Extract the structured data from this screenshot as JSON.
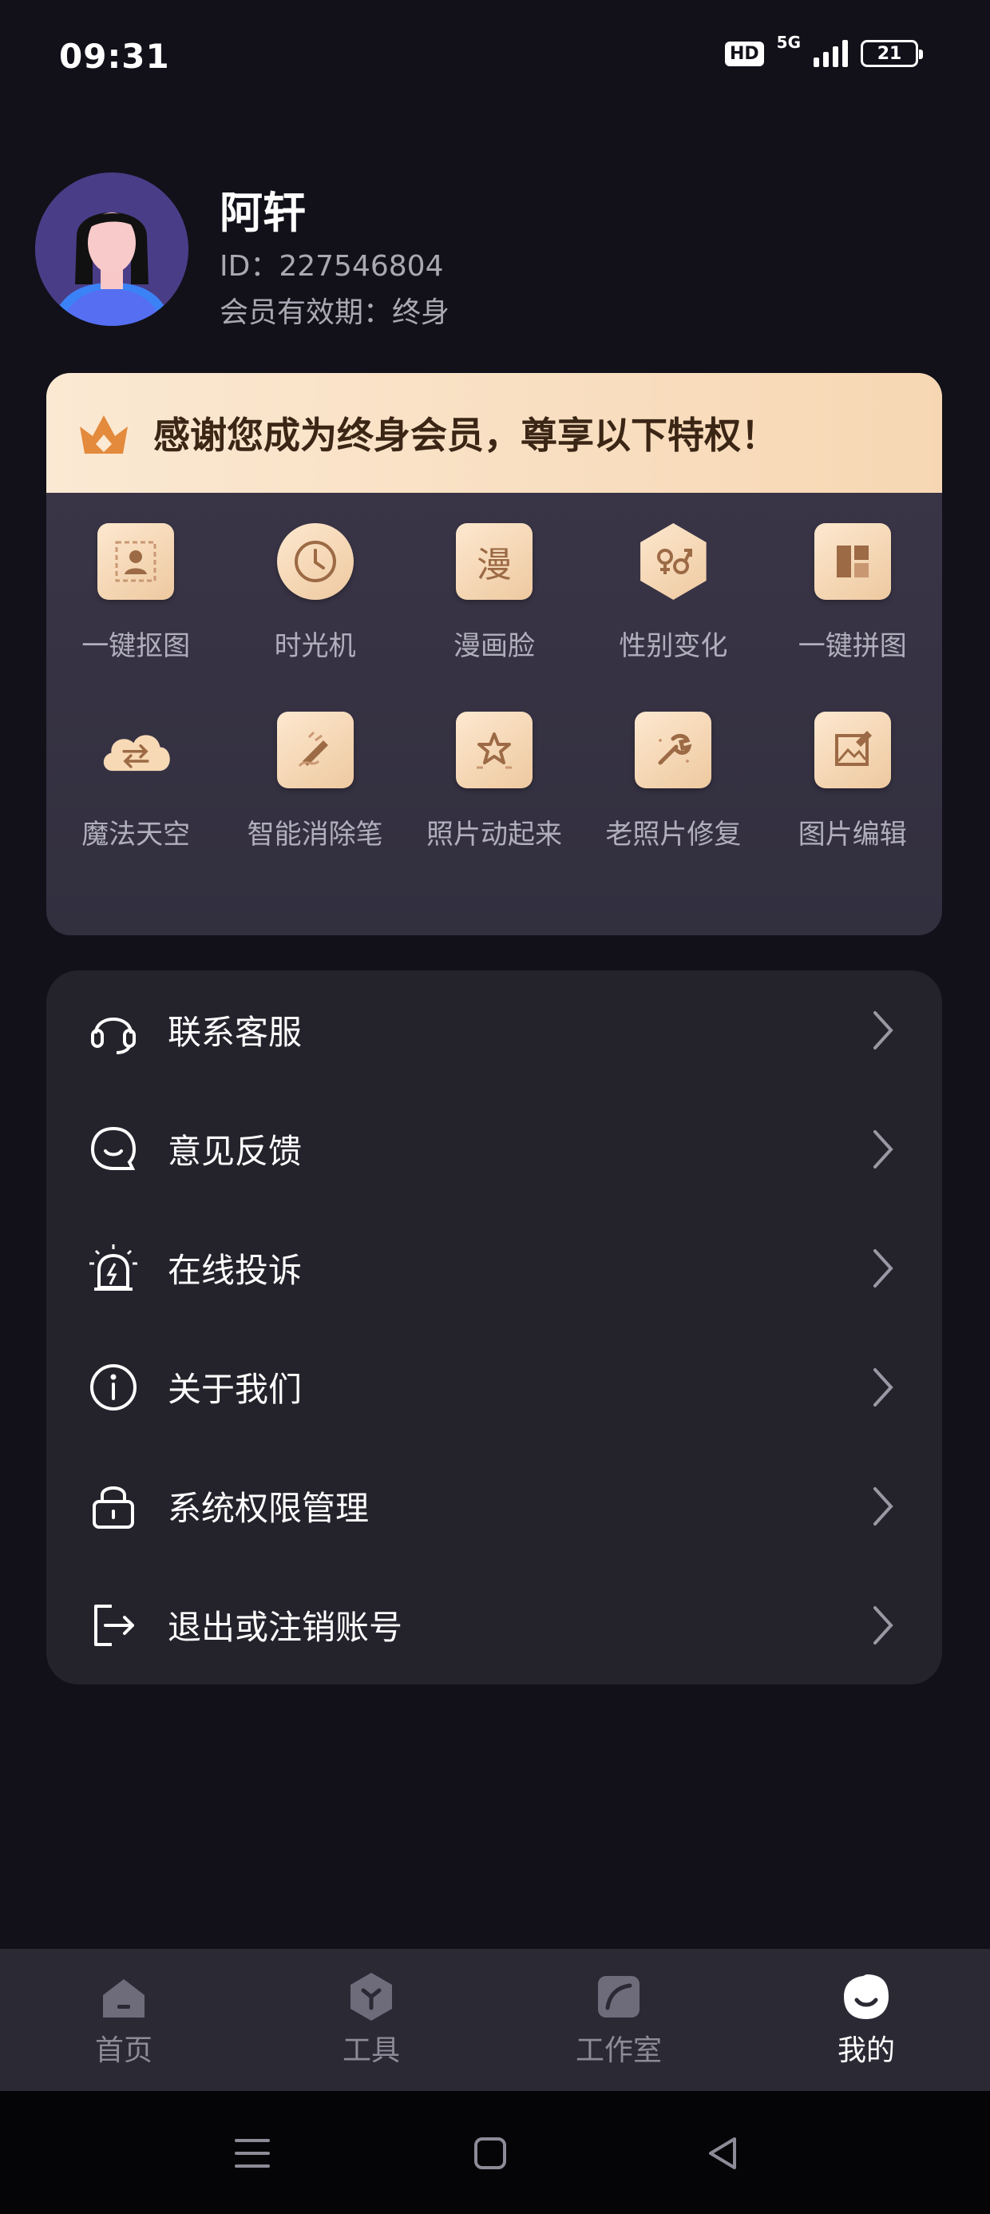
{
  "status_bar": {
    "time": "09:31",
    "hd": "HD",
    "network": "5G",
    "battery": "21"
  },
  "profile": {
    "name": "阿轩",
    "id": "ID：227546804",
    "membership": "会员有效期：终身"
  },
  "vip": {
    "banner_text": "感谢您成为终身会员，尊享以下特权！",
    "privileges": [
      {
        "label": "一键抠图",
        "icon": "portrait-cutout-icon"
      },
      {
        "label": "时光机",
        "icon": "clock-icon"
      },
      {
        "label": "漫画脸",
        "icon": "comic-face-icon",
        "glyph": "漫"
      },
      {
        "label": "性别变化",
        "icon": "gender-swap-icon"
      },
      {
        "label": "一键拼图",
        "icon": "collage-icon"
      },
      {
        "label": "魔法天空",
        "icon": "magic-sky-cloud-icon"
      },
      {
        "label": "智能消除笔",
        "icon": "eraser-pen-icon"
      },
      {
        "label": "照片动起来",
        "icon": "animate-photo-icon"
      },
      {
        "label": "老照片修复",
        "icon": "photo-repair-icon"
      },
      {
        "label": "图片编辑",
        "icon": "image-edit-icon"
      }
    ]
  },
  "menu": [
    {
      "label": "联系客服",
      "icon": "headset-icon"
    },
    {
      "label": "意见反馈",
      "icon": "feedback-bubble-icon"
    },
    {
      "label": "在线投诉",
      "icon": "alarm-icon"
    },
    {
      "label": "关于我们",
      "icon": "info-icon"
    },
    {
      "label": "系统权限管理",
      "icon": "lock-icon"
    },
    {
      "label": "退出或注销账号",
      "icon": "logout-icon"
    }
  ],
  "bottom_nav": [
    {
      "label": "首页",
      "icon": "home-icon",
      "active": false
    },
    {
      "label": "工具",
      "icon": "tools-icon",
      "active": false
    },
    {
      "label": "工作室",
      "icon": "studio-icon",
      "active": false
    },
    {
      "label": "我的",
      "icon": "profile-smile-icon",
      "active": true
    }
  ],
  "colors": {
    "background": "#12111a",
    "vip_banner": "#f7d7b3",
    "card": "#24232c",
    "active_nav": "#ffffff",
    "inactive_nav": "#8d8b97"
  }
}
